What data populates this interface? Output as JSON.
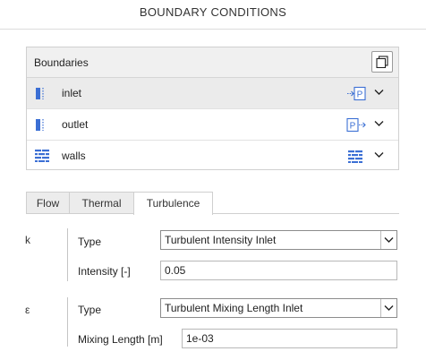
{
  "header": {
    "title": "BOUNDARY CONDITIONS"
  },
  "boundaries": {
    "title": "Boundaries",
    "copy_icon": "copy-icon",
    "items": [
      {
        "label": "inlet",
        "type_icon": "pressure-inlet-icon",
        "selected": true
      },
      {
        "label": "outlet",
        "type_icon": "pressure-outlet-icon",
        "selected": false
      },
      {
        "label": "walls",
        "type_icon": "wall-icon",
        "selected": false
      }
    ]
  },
  "tabs": [
    {
      "label": "Flow",
      "active": false
    },
    {
      "label": "Thermal",
      "active": false
    },
    {
      "label": "Turbulence",
      "active": true
    }
  ],
  "turbulence": {
    "k": {
      "symbol": "k",
      "type_label": "Type",
      "type_value": "Turbulent Intensity Inlet",
      "field_label": "Intensity [-]",
      "field_value": "0.05"
    },
    "epsilon": {
      "symbol": "ε",
      "type_label": "Type",
      "type_value": "Turbulent Mixing Length Inlet",
      "field_label": "Mixing Length [m]",
      "field_value": "1e-03"
    }
  },
  "colors": {
    "accent_blue": "#3b6fd4",
    "selected_row": "#ebebeb",
    "header_bg": "#f0f0f0"
  }
}
